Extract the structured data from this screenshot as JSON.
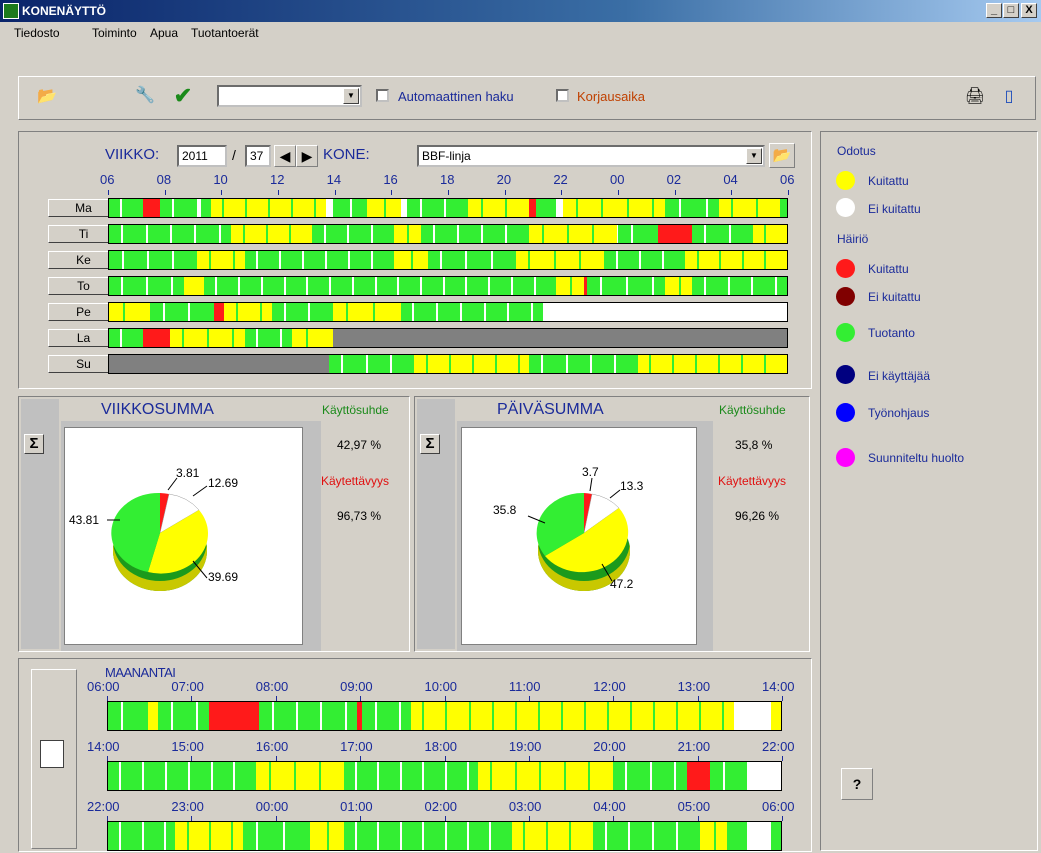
{
  "window": {
    "title": "KONENÄYTTÖ",
    "btn_min": "_",
    "btn_max": "□",
    "btn_close": "X"
  },
  "menu": [
    "Tiedosto",
    "Toiminto",
    "Apua",
    "Tuotantoerät"
  ],
  "toolbar": {
    "auto_fetch": "Automaattinen haku",
    "fix_time": "Korjausaika",
    "combo_value": ""
  },
  "week": {
    "label": "VIIKKO:",
    "year": "2011",
    "sep": "/",
    "week_no": "37",
    "machine_label": "KONE:",
    "machine": "BBF-linja"
  },
  "hours": [
    "06",
    "08",
    "10",
    "12",
    "14",
    "16",
    "18",
    "20",
    "22",
    "00",
    "02",
    "04",
    "06"
  ],
  "days": [
    {
      "name": "Ma",
      "segs": [
        [
          "g",
          0,
          0.05
        ],
        [
          "r",
          0.05,
          0.075
        ],
        [
          "g",
          0.075,
          0.13
        ],
        [
          "w",
          0.13,
          0.135
        ],
        [
          "g",
          0.135,
          0.15
        ],
        [
          "y",
          0.15,
          0.32
        ],
        [
          "w",
          0.32,
          0.33
        ],
        [
          "g",
          0.33,
          0.38
        ],
        [
          "y",
          0.38,
          0.43
        ],
        [
          "w",
          0.43,
          0.44
        ],
        [
          "g",
          0.44,
          0.53
        ],
        [
          "y",
          0.53,
          0.62
        ],
        [
          "r",
          0.62,
          0.63
        ],
        [
          "g",
          0.63,
          0.66
        ],
        [
          "w",
          0.66,
          0.67
        ],
        [
          "y",
          0.67,
          0.82
        ],
        [
          "g",
          0.82,
          0.9
        ],
        [
          "y",
          0.9,
          0.99
        ],
        [
          "g",
          0.99,
          1
        ]
      ]
    },
    {
      "name": "Ti",
      "segs": [
        [
          "g",
          0,
          0.18
        ],
        [
          "y",
          0.18,
          0.3
        ],
        [
          "g",
          0.3,
          0.42
        ],
        [
          "y",
          0.42,
          0.46
        ],
        [
          "g",
          0.46,
          0.62
        ],
        [
          "y",
          0.62,
          0.75
        ],
        [
          "g",
          0.75,
          0.81
        ],
        [
          "r",
          0.81,
          0.86
        ],
        [
          "g",
          0.86,
          0.95
        ],
        [
          "y",
          0.95,
          1
        ]
      ]
    },
    {
      "name": "Ke",
      "segs": [
        [
          "g",
          0,
          0.13
        ],
        [
          "y",
          0.13,
          0.2
        ],
        [
          "g",
          0.2,
          0.42
        ],
        [
          "y",
          0.42,
          0.47
        ],
        [
          "g",
          0.47,
          0.6
        ],
        [
          "y",
          0.6,
          0.73
        ],
        [
          "g",
          0.73,
          0.85
        ],
        [
          "y",
          0.85,
          1
        ]
      ]
    },
    {
      "name": "To",
      "segs": [
        [
          "g",
          0,
          0.11
        ],
        [
          "y",
          0.11,
          0.14
        ],
        [
          "g",
          0.14,
          0.66
        ],
        [
          "y",
          0.66,
          0.7
        ],
        [
          "r",
          0.7,
          0.705
        ],
        [
          "g",
          0.705,
          0.82
        ],
        [
          "y",
          0.82,
          0.86
        ],
        [
          "g",
          0.86,
          1
        ]
      ]
    },
    {
      "name": "Pe",
      "segs": [
        [
          "y",
          0,
          0.06
        ],
        [
          "g",
          0.06,
          0.155
        ],
        [
          "r",
          0.155,
          0.17
        ],
        [
          "y",
          0.17,
          0.24
        ],
        [
          "g",
          0.24,
          0.33
        ],
        [
          "y",
          0.33,
          0.43
        ],
        [
          "g",
          0.43,
          0.64
        ],
        [
          "w",
          0.64,
          1
        ]
      ]
    },
    {
      "name": "La",
      "segs": [
        [
          "g",
          0,
          0.05
        ],
        [
          "r",
          0.05,
          0.09
        ],
        [
          "y",
          0.09,
          0.2
        ],
        [
          "g",
          0.2,
          0.27
        ],
        [
          "y",
          0.27,
          0.33
        ],
        [
          "x",
          0.33,
          1
        ]
      ]
    },
    {
      "name": "Su",
      "segs": [
        [
          "x",
          0,
          0.325
        ],
        [
          "g",
          0.325,
          0.45
        ],
        [
          "y",
          0.45,
          0.62
        ],
        [
          "g",
          0.62,
          0.78
        ],
        [
          "y",
          0.78,
          1
        ]
      ]
    }
  ],
  "weeksum": {
    "title": "VIIKKOSUMMA",
    "sigma": "Σ",
    "usage_label": "Käyttösuhde",
    "usage": "42,97 %",
    "avail_label": "Käytettävyys",
    "avail": "96,73 %",
    "l1": "3.81",
    "l2": "12.69",
    "l3": "43.81",
    "l4": "39.69"
  },
  "daysum": {
    "title": "PÄIVÄSUMMA",
    "sigma": "Σ",
    "usage_label": "Käyttösuhde",
    "usage": "35,8 %",
    "avail_label": "Käytettävyys",
    "avail": "96,26 %",
    "l1": "3.7",
    "l2": "13.3",
    "l3": "35.8",
    "l4": "47.2"
  },
  "legend": {
    "odotus": "Odotus",
    "kuitattu": "Kuitattu",
    "ei_kuitattu": "Ei kuitattu",
    "hairio": "Häiriö",
    "h_kuitattu": "Kuitattu",
    "h_ei_kuitattu": "Ei kuitattu",
    "tuotanto": "Tuotanto",
    "ei_kayttajaa": "Ei käyttäjää",
    "tyonohjaus": "Työnohjaus",
    "huolto": "Suunniteltu huolto",
    "help": "?"
  },
  "detail": {
    "day": "MAANANTAI",
    "rows": [
      {
        "hours": [
          "06:00",
          "07:00",
          "08:00",
          "09:00",
          "10:00",
          "11:00",
          "12:00",
          "13:00",
          "14:00"
        ],
        "segs": [
          [
            "g",
            0,
            0.06
          ],
          [
            "y",
            0.06,
            0.075
          ],
          [
            "g",
            0.075,
            0.15
          ],
          [
            "r",
            0.15,
            0.225
          ],
          [
            "g",
            0.225,
            0.37
          ],
          [
            "r",
            0.37,
            0.378
          ],
          [
            "g",
            0.378,
            0.45
          ],
          [
            "y",
            0.45,
            0.93
          ],
          [
            "w",
            0.93,
            0.985
          ],
          [
            "y",
            0.985,
            1
          ]
        ]
      },
      {
        "hours": [
          "14:00",
          "15:00",
          "16:00",
          "17:00",
          "18:00",
          "19:00",
          "20:00",
          "21:00",
          "22:00"
        ],
        "segs": [
          [
            "g",
            0,
            0.22
          ],
          [
            "y",
            0.22,
            0.35
          ],
          [
            "g",
            0.35,
            0.55
          ],
          [
            "y",
            0.55,
            0.75
          ],
          [
            "g",
            0.75,
            0.86
          ],
          [
            "r",
            0.86,
            0.895
          ],
          [
            "g",
            0.895,
            0.95
          ],
          [
            "w",
            0.95,
            1
          ]
        ]
      },
      {
        "hours": [
          "22:00",
          "23:00",
          "00:00",
          "01:00",
          "02:00",
          "03:00",
          "04:00",
          "05:00",
          "06:00"
        ],
        "segs": [
          [
            "g",
            0,
            0.1
          ],
          [
            "y",
            0.1,
            0.2
          ],
          [
            "g",
            0.2,
            0.3
          ],
          [
            "y",
            0.3,
            0.35
          ],
          [
            "g",
            0.35,
            0.6
          ],
          [
            "y",
            0.6,
            0.72
          ],
          [
            "g",
            0.72,
            0.88
          ],
          [
            "y",
            0.88,
            0.92
          ],
          [
            "g",
            0.92,
            0.95
          ],
          [
            "w",
            0.95,
            0.985
          ],
          [
            "g",
            0.985,
            1
          ]
        ]
      }
    ]
  },
  "colors": {
    "g": "#33ee33",
    "y": "#ffff00",
    "r": "#ff1a1a",
    "w": "#ffffff",
    "x": "#808080",
    "dr": "#800000",
    "navy": "#000080",
    "blue": "#0000ff",
    "magenta": "#ff00ff"
  }
}
